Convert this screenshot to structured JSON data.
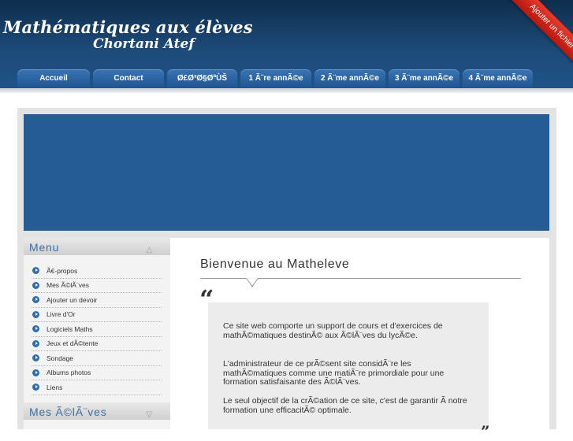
{
  "site": {
    "title": "Mathématiques aux élèves",
    "author": "Chortani Atef",
    "ribbon": "Ajouter un fichier"
  },
  "nav": {
    "tabs": [
      {
        "label": "Accueil"
      },
      {
        "label": "Contact"
      },
      {
        "label": "Ø£Ø³Ø§ØªÙŠ"
      },
      {
        "label": "1 Ã¨re annÃ©e"
      },
      {
        "label": "2 Ã¨me annÃ©e"
      },
      {
        "label": "3 Ã¨me annÃ©e"
      },
      {
        "label": "4 Ã¨me annÃ©e"
      }
    ]
  },
  "sidebar": {
    "menu_title": "Menu",
    "items": [
      {
        "label": "Ã€-propos"
      },
      {
        "label": "Mes Ã©lÃ¨ves"
      },
      {
        "label": "Ajouter un devoir"
      },
      {
        "label": "Livre d'Or"
      },
      {
        "label": "Logiciels Maths"
      },
      {
        "label": "Jeux et dÃ©tente"
      },
      {
        "label": "Sondage"
      },
      {
        "label": "Albums photos"
      },
      {
        "label": "Liens"
      }
    ],
    "second_title": "Mes Ã©lÃ¨ves",
    "icons": {
      "bullet": "play-circle-icon",
      "collapse": "triangle-up-icon",
      "expand": "triangle-down-icon"
    }
  },
  "main": {
    "welcome": "Bienvenue au Matheleve",
    "quote_open": "“",
    "quote_close": "”",
    "paragraphs": [
      "Ce site web comporte un support de cours et d'exercices de mathÃ©matiques destinÃ© aux Ã©lÃ¨ves du lycÃ©e.",
      "L'administrateur de ce prÃ©sent site considÃ¨re les mathÃ©matiques comme une matiÃ¨re primordiale pour une formation satisfaisante des Ã©lÃ¨ves.",
      "Le seul objectif de la crÃ©ation de ce site, c'est de garantir Ã  notre formation une efficacitÃ© optimale."
    ]
  },
  "colors": {
    "header": "#1c4a78",
    "banner": "#265c95",
    "tab": "#2b65a3",
    "accent": "#3a6ea5",
    "ribbon": "#d42a1d"
  }
}
